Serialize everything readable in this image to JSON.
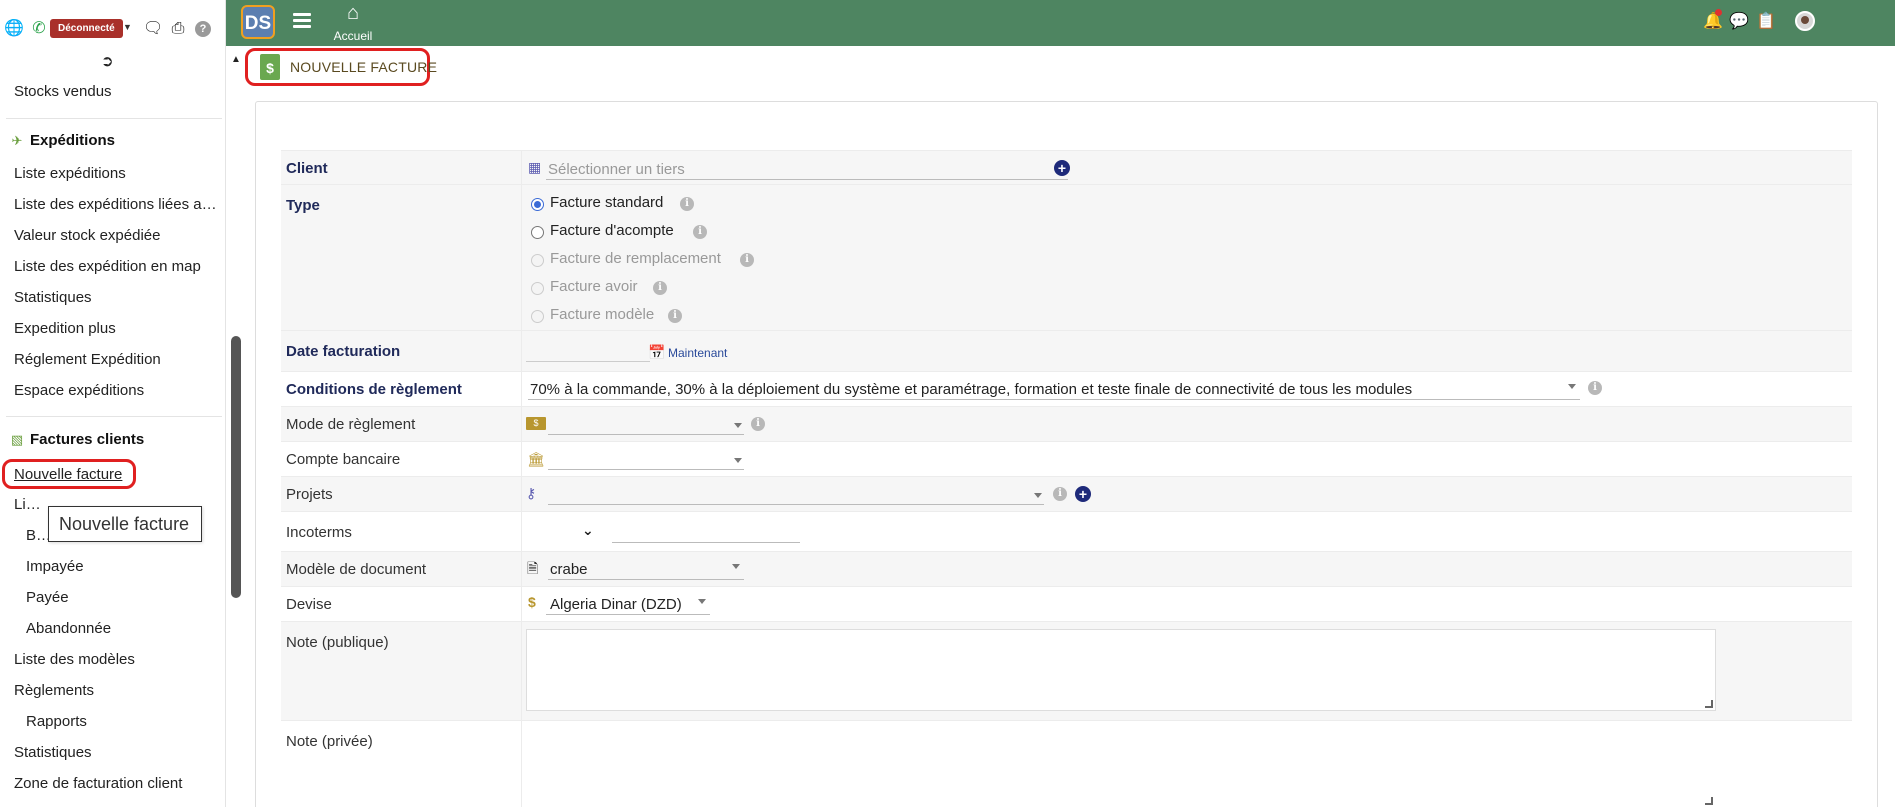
{
  "sidebar": {
    "status_badge": "Déconnecté",
    "help": "?",
    "items_top": [
      "Stocks vendus"
    ],
    "section_expeditions": "Expéditions",
    "expeditions_items": [
      "Liste expéditions",
      "Liste des expéditions liées au...",
      "Valeur stock expédiée",
      "Liste des expédition en map",
      "Statistiques",
      "Expedition plus",
      "Réglement Expédition",
      "Espace expéditions"
    ],
    "section_factures": "Factures clients",
    "active_item": "Nouvelle facture",
    "liste": "Liste",
    "sub_brouillon": "Bro",
    "sub_impayee": "Impayée",
    "sub_payee": "Payée",
    "sub_abandonnee": "Abandonnée",
    "liste_modeles": "Liste des modèles",
    "reglements": "Règlements",
    "sub_rapports": "Rapports",
    "statistiques": "Statistiques",
    "zone_facturation": "Zone de facturation client",
    "tooltip": "Nouvelle facture"
  },
  "topbar": {
    "logo_text": "DS",
    "home_label": "Accueil"
  },
  "page": {
    "title": "NOUVELLE FACTURE"
  },
  "form": {
    "client": {
      "label": "Client",
      "placeholder": "Sélectionner un tiers"
    },
    "type": {
      "label": "Type",
      "options": [
        {
          "label": "Facture standard",
          "checked": true,
          "disabled": false
        },
        {
          "label": "Facture d'acompte",
          "checked": false,
          "disabled": false
        },
        {
          "label": "Facture de remplacement",
          "checked": false,
          "disabled": true
        },
        {
          "label": "Facture avoir",
          "checked": false,
          "disabled": true
        },
        {
          "label": "Facture modèle",
          "checked": false,
          "disabled": true
        }
      ]
    },
    "date": {
      "label": "Date facturation",
      "value": "",
      "now_link": "Maintenant"
    },
    "conditions": {
      "label": "Conditions de règlement",
      "value": "70% à la commande, 30% à la déploiement du système et paramétrage, formation et teste finale de connectivité de tous les modules"
    },
    "mode": {
      "label": "Mode de règlement",
      "value": ""
    },
    "compte": {
      "label": "Compte bancaire",
      "value": ""
    },
    "projets": {
      "label": "Projets",
      "value": ""
    },
    "incoterms": {
      "label": "Incoterms",
      "value": ""
    },
    "modele": {
      "label": "Modèle de document",
      "value": "crabe"
    },
    "devise": {
      "label": "Devise",
      "value": "Algeria Dinar (DZD)"
    },
    "note_publique": {
      "label": "Note (publique)",
      "value": ""
    },
    "note_privee": {
      "label": "Note (privée)",
      "value": ""
    }
  },
  "colors": {
    "topbar": "#4e8561",
    "highlight": "#e02020",
    "required_label": "#202a5a",
    "accent_blue": "#1e2a7a"
  }
}
